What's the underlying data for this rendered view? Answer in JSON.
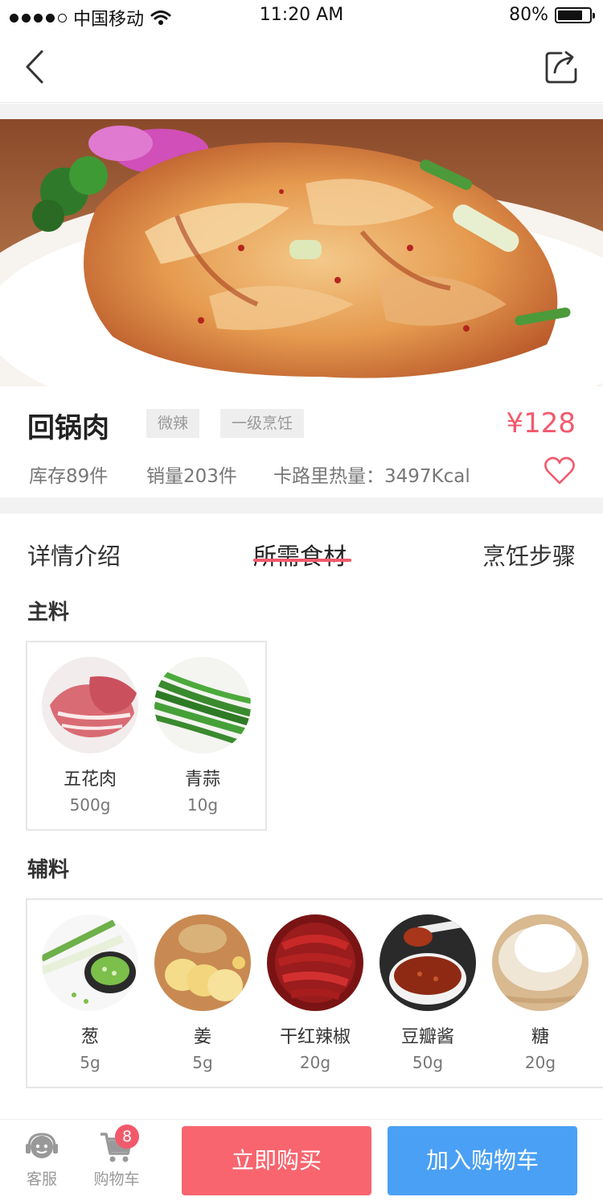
{
  "status_bar": {
    "carrier": "中国移动",
    "time": "11:20 AM",
    "battery": "80%",
    "battery_level": 0.8
  },
  "nav": {
    "back_icon": "chevron-left-icon",
    "share_icon": "share-icon"
  },
  "product": {
    "name": "回锅肉",
    "tags": [
      "微辣",
      "一级烹饪"
    ],
    "price": "¥128",
    "stock": "库存89件",
    "sales": "销量203件",
    "calories": "卡路里热量：3497Kcal",
    "favorite_icon": "heart-outline-icon"
  },
  "tabs": [
    {
      "label": "详情介绍",
      "active": false
    },
    {
      "label": "所需食材",
      "active": true
    },
    {
      "label": "烹饪步骤",
      "active": false
    }
  ],
  "main_ingredients": {
    "title": "主料",
    "items": [
      {
        "name": "五花肉",
        "amount": "500g"
      },
      {
        "name": "青蒜",
        "amount": "10g"
      }
    ]
  },
  "side_ingredients": {
    "title": "辅料",
    "items": [
      {
        "name": "葱",
        "amount": "5g"
      },
      {
        "name": "姜",
        "amount": "5g"
      },
      {
        "name": "干红辣椒",
        "amount": "20g"
      },
      {
        "name": "豆瓣酱",
        "amount": "50g"
      },
      {
        "name": "糖",
        "amount": "20g"
      }
    ]
  },
  "bottom_bar": {
    "service_label": "客服",
    "cart_label": "购物车",
    "cart_count": "8",
    "buy_now": "立即购买",
    "add_to_cart": "加入购物车"
  },
  "colors": {
    "accent_red": "#f25a6c",
    "buy_button": "#f8656f",
    "cart_button": "#4aa0f5"
  }
}
